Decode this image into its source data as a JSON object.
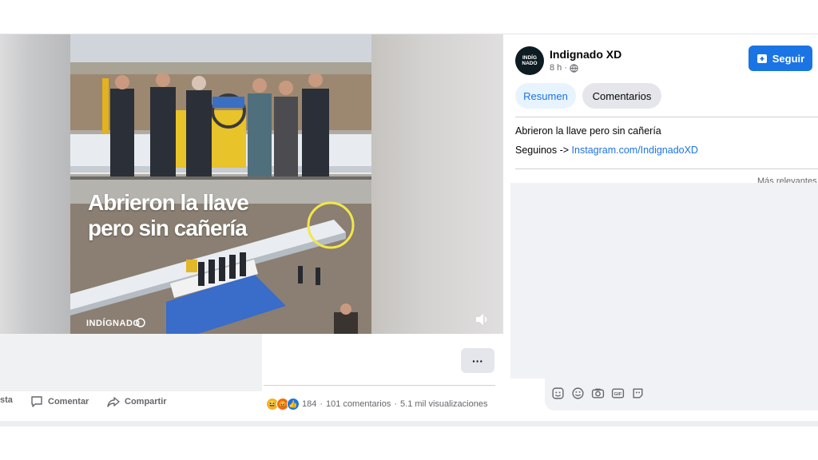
{
  "video": {
    "headline_line1": "Abrieron la llave",
    "headline_line2": "pero sin cañería",
    "watermark": "INDÍGNADO"
  },
  "actions": {
    "react_partial": "sta",
    "comment_label": "Comentar",
    "share_label": "Compartir",
    "more_label": "···"
  },
  "stats": {
    "reaction_count": "184",
    "separator": "·",
    "comments": "101 comentarios",
    "views": "5.1 mil visualizaciones"
  },
  "post": {
    "page_name": "Indignado XD",
    "avatar_line1": "INDÍG",
    "avatar_line2": "NADO",
    "time": "8 h ·",
    "follow_label": "Seguir",
    "tabs": [
      {
        "label": "Resumen",
        "active": true
      },
      {
        "label": "Comentarios",
        "active": false
      }
    ],
    "text": "Abrieron la llave pero sin cañería",
    "link_prefix": "Seguinos ->",
    "link_text": "Instagram.com/IndignadoXD",
    "sort_label": "Más relevantes"
  },
  "colors": {
    "brand_blue": "#1b74e4",
    "tab_active_bg": "#e7f3ff",
    "muted_text": "#65676b"
  },
  "icons": [
    "comment-icon",
    "share-icon",
    "globe-icon",
    "follow-icon",
    "volume-icon",
    "sticker-icon",
    "emoji-icon",
    "camera-icon",
    "gif-icon",
    "avatar-sticker-icon"
  ]
}
